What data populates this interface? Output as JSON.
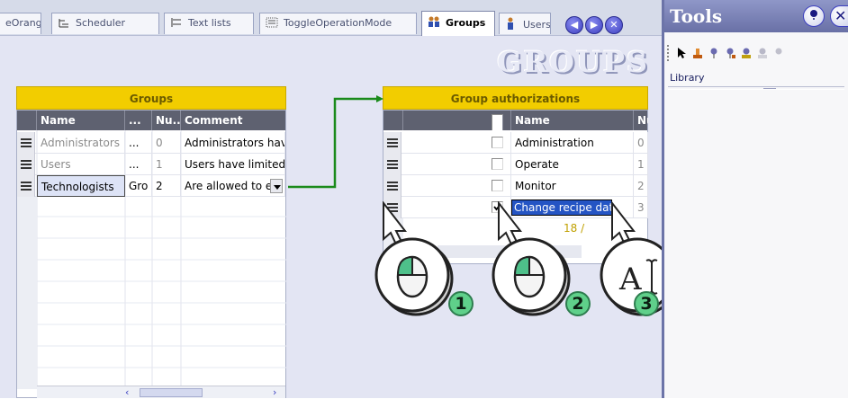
{
  "tabs": [
    {
      "label": "eOrange",
      "icon": "none"
    },
    {
      "label": "Scheduler",
      "icon": "scheduler-icon"
    },
    {
      "label": "Text lists",
      "icon": "text-list-icon"
    },
    {
      "label": "ToggleOperationMode",
      "icon": "script-icon"
    },
    {
      "label": "Groups",
      "icon": "groups-icon"
    },
    {
      "label": "Users",
      "icon": "users-icon"
    }
  ],
  "editor_title": "GROUPS",
  "groups_table": {
    "title": "Groups",
    "columns": [
      "Name",
      "...",
      "Nu...",
      "Comment"
    ],
    "rows": [
      {
        "name": "Administrators",
        "display": "...",
        "number": "0",
        "comment": "Administrators have"
      },
      {
        "name": "Users",
        "display": "...",
        "number": "1",
        "comment": "Users have limited a"
      },
      {
        "name": "Technologists",
        "display": "Gro",
        "number": "2",
        "comment": "Are allowed to ed"
      }
    ]
  },
  "auth_table": {
    "title": "Group authorizations",
    "columns": [
      "",
      "Name",
      "Nu"
    ],
    "rows": [
      {
        "name": "Administration",
        "number": "0",
        "checked": false
      },
      {
        "name": "Operate",
        "number": "1",
        "checked": false
      },
      {
        "name": "Monitor",
        "number": "2",
        "checked": false
      },
      {
        "name": "Change recipe data",
        "number": "3",
        "checked": true
      }
    ],
    "counter": "18 /"
  },
  "tools": {
    "title": "Tools",
    "section": "Library"
  },
  "callouts": [
    "1",
    "2",
    "3"
  ],
  "colors": {
    "table_title_bg": "#f2cd00",
    "header_bg": "#5e6170",
    "connector": "#1a8a1a",
    "selection": "#2454c4",
    "callout_green": "#5fd08a"
  }
}
